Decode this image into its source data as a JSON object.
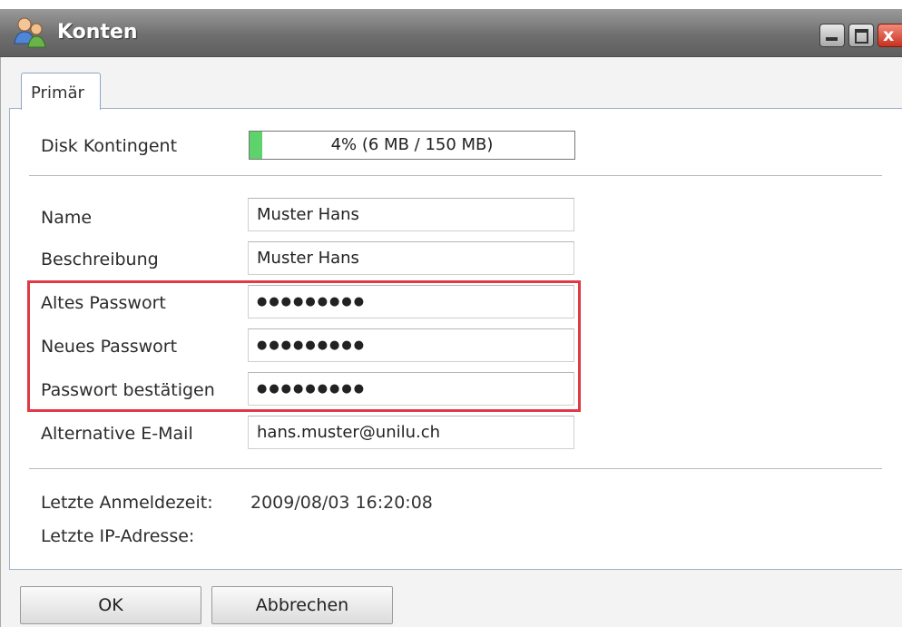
{
  "window": {
    "title": "Konten",
    "icon": "user-accounts-icon",
    "controls": [
      "minimize-icon",
      "maximize-icon",
      "close-icon"
    ],
    "close_glyph": "x"
  },
  "tabs": [
    {
      "label": "Primär",
      "active": true
    }
  ],
  "quota": {
    "label": "Disk Kontingent",
    "text": "4% (6 MB / 150 MB)",
    "percent": 4,
    "fill_color": "#5fd36b"
  },
  "form": {
    "name": {
      "label": "Name",
      "value": "Muster Hans"
    },
    "description": {
      "label": "Beschreibung",
      "value": "Muster Hans"
    },
    "old_password": {
      "label": "Altes Passwort",
      "value": "●●●●●●●●●"
    },
    "new_password": {
      "label": "Neues Passwort",
      "value": "●●●●●●●●●"
    },
    "confirm_password": {
      "label": "Passwort bestätigen",
      "value": "●●●●●●●●●"
    },
    "alt_email": {
      "label": "Alternative E-Mail",
      "value": "hans.muster@unilu.ch"
    }
  },
  "highlight_color": "#e03a45",
  "info": {
    "last_login_label": "Letzte Anmeldezeit:",
    "last_login_value": "2009/08/03 16:20:08",
    "last_ip_label": "Letzte IP-Adresse:",
    "last_ip_value": ""
  },
  "buttons": {
    "ok": "OK",
    "cancel": "Abbrechen"
  }
}
